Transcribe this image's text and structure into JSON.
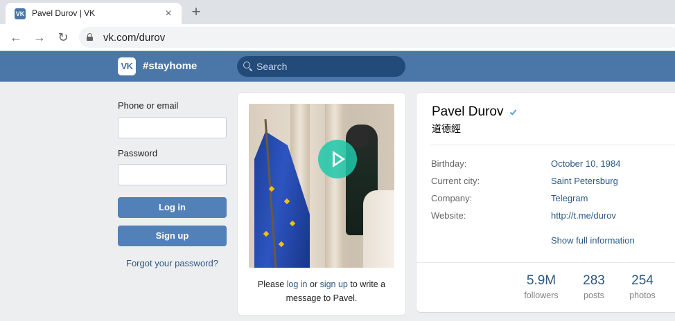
{
  "browser": {
    "tab_favicon": "VK",
    "tab_title": "Pavel Durov | VK",
    "tab_close": "×",
    "new_tab": "+",
    "back": "←",
    "forward": "→",
    "reload": "↻",
    "url": "vk.com/durov"
  },
  "header": {
    "logo": "VK",
    "brand": "#stayhome",
    "search_placeholder": "Search"
  },
  "login": {
    "phone_label": "Phone or email",
    "phone_value": "",
    "password_label": "Password",
    "password_value": "",
    "login_button": "Log in",
    "signup_button": "Sign up",
    "forgot_link": "Forgot your password?"
  },
  "video": {
    "caption_prefix": "Please ",
    "caption_login": "log in",
    "caption_middle": " or ",
    "caption_signup": "sign up",
    "caption_suffix": " to write a message to Pavel."
  },
  "profile": {
    "name": "Pavel Durov",
    "status": "道德經",
    "info": [
      {
        "label": "Birthday:",
        "value": "October 10, 1984"
      },
      {
        "label": "Current city:",
        "value": "Saint Petersburg"
      },
      {
        "label": "Company:",
        "value": "Telegram"
      },
      {
        "label": "Website:",
        "value": "http://t.me/durov"
      }
    ],
    "show_full": "Show full information",
    "counters": [
      {
        "value": "5.9M",
        "label": "followers"
      },
      {
        "value": "283",
        "label": "posts"
      },
      {
        "value": "254",
        "label": "photos"
      }
    ]
  },
  "colors": {
    "vk_blue": "#4a76a8",
    "link": "#2a5885",
    "button": "#5181b8",
    "play_accent": "#1ec8aa"
  }
}
